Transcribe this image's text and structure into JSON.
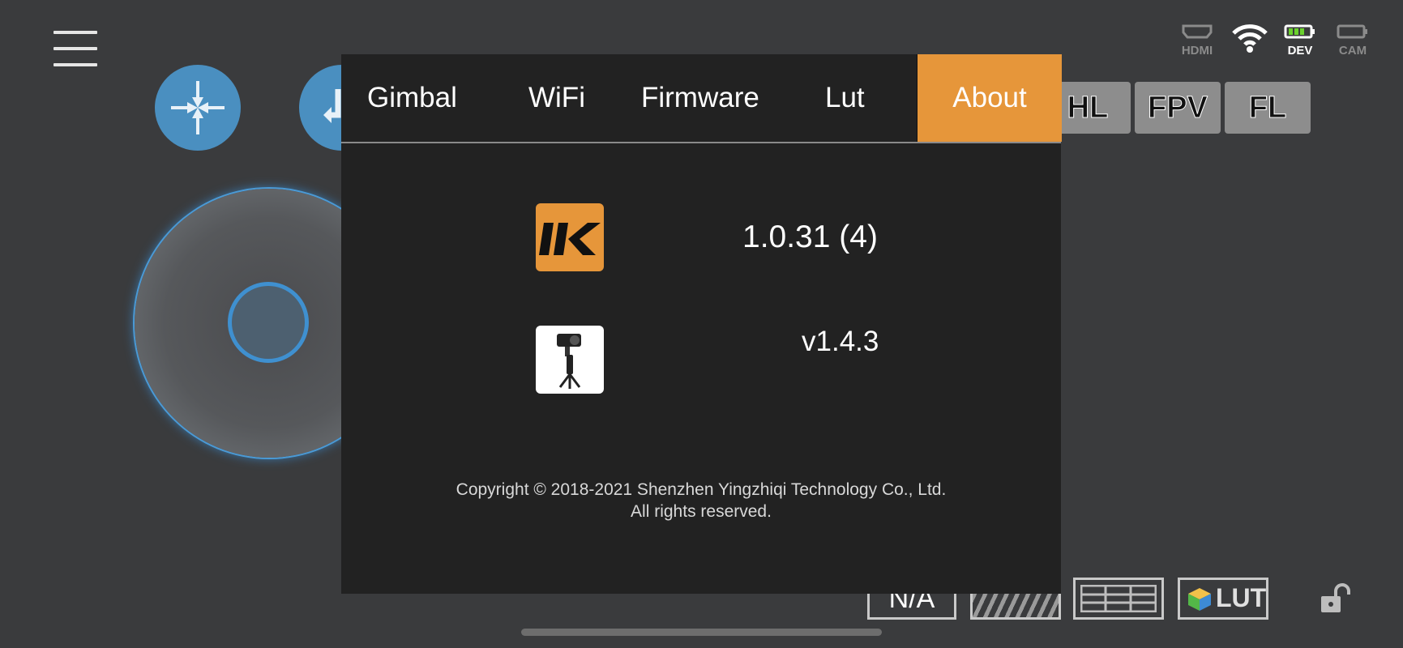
{
  "status_bar": {
    "hdmi_label": "HDMI",
    "dev_label": "DEV",
    "cam_label": "CAM",
    "icons": [
      "hdmi-icon",
      "wifi-icon",
      "battery-icon",
      "camera-battery-icon"
    ]
  },
  "mode_buttons": [
    "HL",
    "FPV",
    "FL"
  ],
  "bottom_bar": {
    "na_label": "N/A",
    "lut_label": "LUT"
  },
  "dialog": {
    "tabs": [
      "Gimbal",
      "WiFi",
      "Firmware",
      "Lut",
      "About"
    ],
    "active_tab": "About",
    "app_version": "1.0.31 (4)",
    "gimbal_version": "v1.4.3",
    "copyright_line1": "Copyright © 2018-2021 Shenzhen Yingzhiqi Technology Co., Ltd.",
    "copyright_line2": "All rights reserved."
  },
  "colors": {
    "accent": "#e6963a",
    "blue": "#4a8fc0",
    "background": "#3a3b3d",
    "dialog": "#222222"
  }
}
